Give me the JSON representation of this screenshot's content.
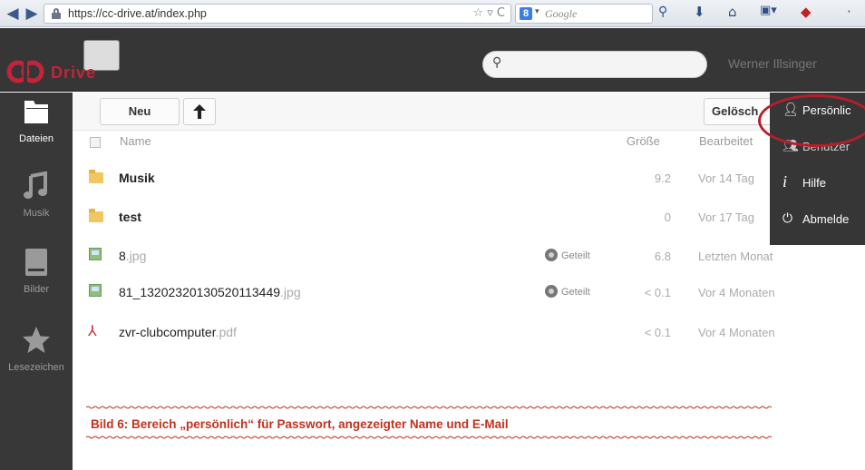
{
  "browser": {
    "url": "https://cc-drive.at/index.php",
    "search_engine_label": "Google",
    "url_bar_icons": "☆ ▿ C"
  },
  "app": {
    "logo_text": "Drive",
    "user_name": "Werner Illsinger",
    "brand_color": "#c4233a"
  },
  "sidebar": {
    "items": [
      {
        "label": "Dateien",
        "icon": "folder-icon",
        "active": true
      },
      {
        "label": "Musik",
        "icon": "music-icon",
        "active": false
      },
      {
        "label": "Bilder",
        "icon": "image-icon",
        "active": false
      },
      {
        "label": "Lesezeichen",
        "icon": "star-icon",
        "active": false
      }
    ]
  },
  "toolbar": {
    "new_label": "Neu",
    "upload_icon": "upload-arrow-icon",
    "deleted_label": "Gelösch"
  },
  "file_list": {
    "headers": {
      "name": "Name",
      "size": "Größe",
      "modified": "Bearbeitet"
    },
    "files": [
      {
        "name": "Musik",
        "ext": "",
        "type": "folder",
        "shared": "",
        "size": "9.2",
        "modified": "Vor 14 Tag"
      },
      {
        "name": "test",
        "ext": "",
        "type": "folder",
        "shared": "",
        "size": "0",
        "modified": "Vor 17 Tag"
      },
      {
        "name": "8",
        "ext": ".jpg",
        "type": "image",
        "shared": "Geteilt",
        "size": "6.8",
        "modified": "Letzten Monat"
      },
      {
        "name": "81_13202320130520113449",
        "ext": ".jpg",
        "type": "image",
        "shared": "Geteilt",
        "size": "< 0.1",
        "modified": "Vor 4 Monaten"
      },
      {
        "name": "zvr-clubcomputer",
        "ext": ".pdf",
        "type": "pdf",
        "shared": "",
        "size": "< 0.1",
        "modified": "Vor 4 Monaten"
      }
    ]
  },
  "user_menu": {
    "items": [
      {
        "label": "Persönlic",
        "icon": "person-icon"
      },
      {
        "label": "Benutzer",
        "icon": "users-icon"
      },
      {
        "label": "Hilfe",
        "icon": "info-icon"
      },
      {
        "label": "Abmelde",
        "icon": "power-icon"
      }
    ],
    "highlight_color": "#b51e2c"
  },
  "caption": {
    "text": "Bild 6: Bereich „persönlich“ für Passwort, angezeigter Name und E-Mail"
  }
}
